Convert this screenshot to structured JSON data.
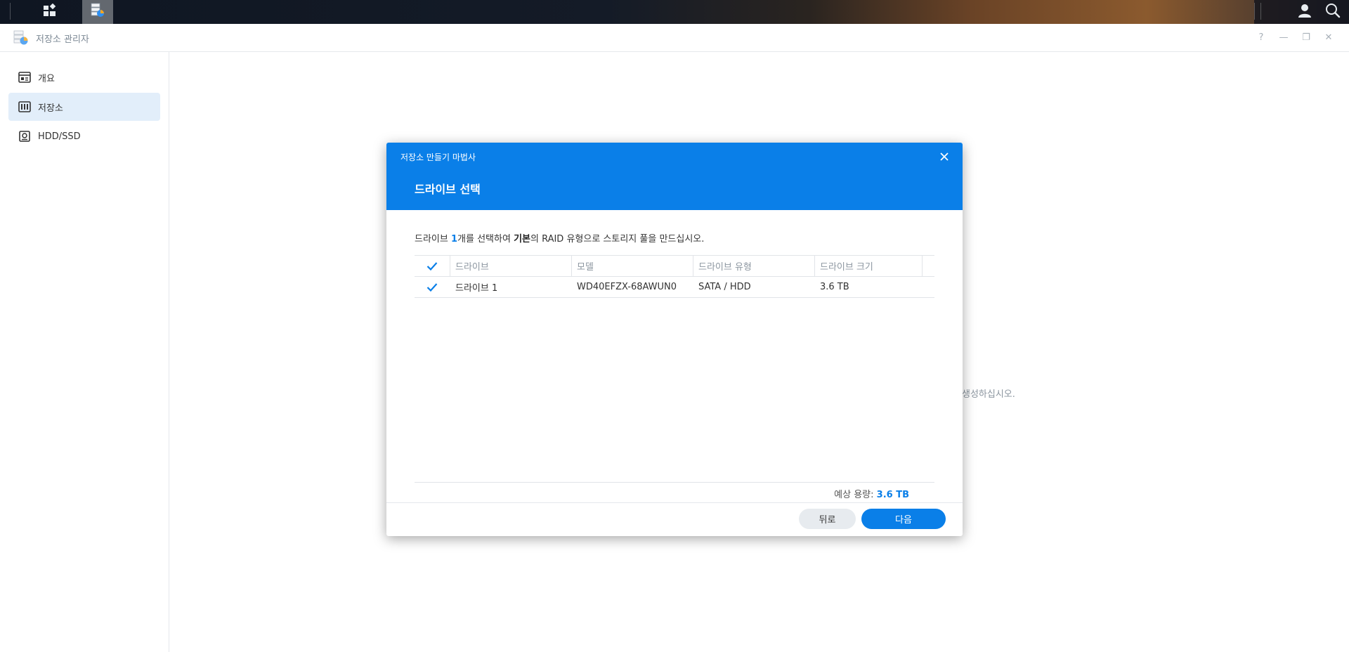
{
  "taskbar": {
    "main_menu_icon": "main-menu-icon",
    "active_app_icon": "storage-manager-icon",
    "user_icon": "user-icon",
    "search_icon": "search-icon"
  },
  "window": {
    "title": "저장소 관리자",
    "controls": [
      "?",
      "—",
      "❐",
      "✕"
    ]
  },
  "sidebar": {
    "items": [
      {
        "label": "개요",
        "icon": "overview-icon",
        "active": false
      },
      {
        "label": "저장소",
        "icon": "storage-icon",
        "active": true
      },
      {
        "label": "HDD/SSD",
        "icon": "hdd-icon",
        "active": false
      }
    ]
  },
  "background": {
    "partial_text": "생성하십시오."
  },
  "dialog": {
    "wizard_title": "저장소 만들기 마법사",
    "step_title": "드라이브 선택",
    "description": {
      "part1": "드라이브 ",
      "count": "1",
      "part2": "개를 선택하여 ",
      "raid": "기본",
      "part3": "의 RAID 유형으로 스토리지 풀을 만드십시오."
    },
    "table": {
      "headers": [
        "드라이브",
        "모델",
        "드라이브 유형",
        "드라이브 크기"
      ],
      "rows": [
        {
          "checked": true,
          "drive": "드라이브 1",
          "model": "WD40EFZX-68AWUN0",
          "type": "SATA / HDD",
          "size": "3.6 TB"
        }
      ]
    },
    "capacity": {
      "label": "예상 용량: ",
      "value": "3.6 TB"
    },
    "buttons": {
      "back": "뒤로",
      "next": "다음"
    },
    "accent_color": "#0a7fe8"
  }
}
